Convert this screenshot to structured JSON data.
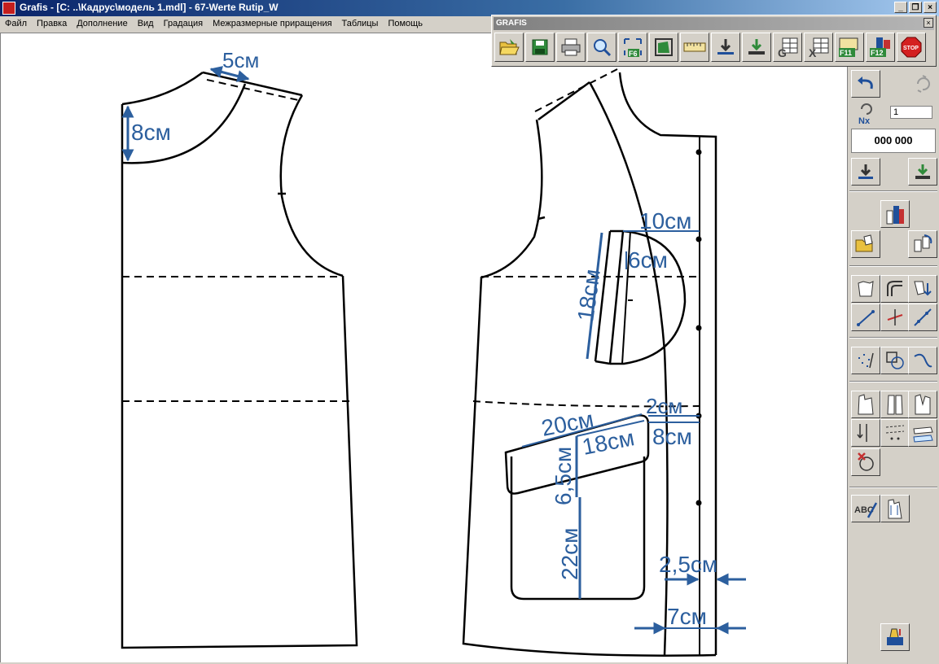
{
  "window": {
    "title": "Grafis - [C: ..\\Кадрус\\модель 1.mdl] - 67-Werte Rutip_W",
    "minimize": "_",
    "restore": "❐",
    "close": "×"
  },
  "menu": [
    "Файл",
    "Правка",
    "Дополнение",
    "Вид",
    "Градация",
    "Межразмерные приращения",
    "Таблицы",
    "Помощь"
  ],
  "toolbar": {
    "title": "GRAFIS",
    "close": "×",
    "buttons": [
      "open-folder-icon",
      "save-icon",
      "print-icon",
      "zoom-icon",
      "fit-f6-icon",
      "frame-icon",
      "ruler-icon",
      "download-icon",
      "download-green-icon",
      "table-g-icon",
      "table-x-icon",
      "f11-icon",
      "f12-icon",
      "stop-icon"
    ],
    "f6_label": "F6",
    "f11_label": "F11",
    "f12_label": "F12",
    "stop_label": "STOP"
  },
  "right_panel": {
    "nx_label": "Nx",
    "nx_value": "1",
    "counter": "000 000"
  },
  "drawing": {
    "dims": {
      "neck_width": "5см",
      "neck_depth": "8см",
      "welt_width": "10см",
      "welt_depth": "6см",
      "welt_length": "18см",
      "offset_2": "2см",
      "offset_8": "8см",
      "flap_20": "20см",
      "flap_18": "18см",
      "flap_65": "6,5см",
      "pocket_22": "22см",
      "placket_25": "2,5см",
      "placket_7": "7см"
    }
  },
  "colors": {
    "dimension": "#2c5f9e",
    "line": "#000000",
    "title_bar": "#0a246a"
  }
}
